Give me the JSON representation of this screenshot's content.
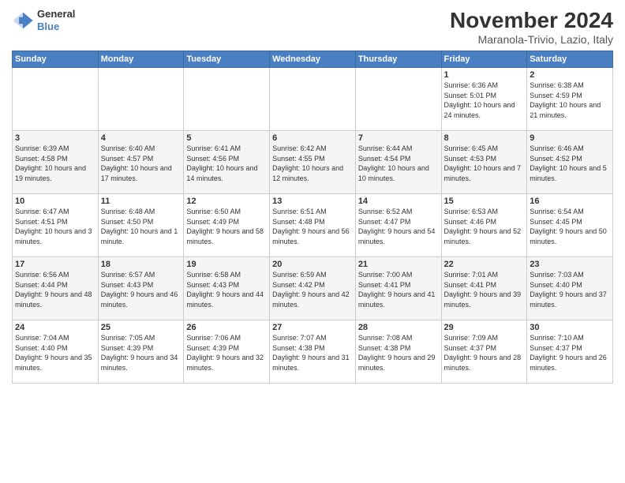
{
  "logo": {
    "general": "General",
    "blue": "Blue"
  },
  "title": "November 2024",
  "location": "Maranola-Trivio, Lazio, Italy",
  "headers": [
    "Sunday",
    "Monday",
    "Tuesday",
    "Wednesday",
    "Thursday",
    "Friday",
    "Saturday"
  ],
  "weeks": [
    [
      {
        "day": "",
        "info": ""
      },
      {
        "day": "",
        "info": ""
      },
      {
        "day": "",
        "info": ""
      },
      {
        "day": "",
        "info": ""
      },
      {
        "day": "",
        "info": ""
      },
      {
        "day": "1",
        "info": "Sunrise: 6:36 AM\nSunset: 5:01 PM\nDaylight: 10 hours and 24 minutes."
      },
      {
        "day": "2",
        "info": "Sunrise: 6:38 AM\nSunset: 4:59 PM\nDaylight: 10 hours and 21 minutes."
      }
    ],
    [
      {
        "day": "3",
        "info": "Sunrise: 6:39 AM\nSunset: 4:58 PM\nDaylight: 10 hours and 19 minutes."
      },
      {
        "day": "4",
        "info": "Sunrise: 6:40 AM\nSunset: 4:57 PM\nDaylight: 10 hours and 17 minutes."
      },
      {
        "day": "5",
        "info": "Sunrise: 6:41 AM\nSunset: 4:56 PM\nDaylight: 10 hours and 14 minutes."
      },
      {
        "day": "6",
        "info": "Sunrise: 6:42 AM\nSunset: 4:55 PM\nDaylight: 10 hours and 12 minutes."
      },
      {
        "day": "7",
        "info": "Sunrise: 6:44 AM\nSunset: 4:54 PM\nDaylight: 10 hours and 10 minutes."
      },
      {
        "day": "8",
        "info": "Sunrise: 6:45 AM\nSunset: 4:53 PM\nDaylight: 10 hours and 7 minutes."
      },
      {
        "day": "9",
        "info": "Sunrise: 6:46 AM\nSunset: 4:52 PM\nDaylight: 10 hours and 5 minutes."
      }
    ],
    [
      {
        "day": "10",
        "info": "Sunrise: 6:47 AM\nSunset: 4:51 PM\nDaylight: 10 hours and 3 minutes."
      },
      {
        "day": "11",
        "info": "Sunrise: 6:48 AM\nSunset: 4:50 PM\nDaylight: 10 hours and 1 minute."
      },
      {
        "day": "12",
        "info": "Sunrise: 6:50 AM\nSunset: 4:49 PM\nDaylight: 9 hours and 58 minutes."
      },
      {
        "day": "13",
        "info": "Sunrise: 6:51 AM\nSunset: 4:48 PM\nDaylight: 9 hours and 56 minutes."
      },
      {
        "day": "14",
        "info": "Sunrise: 6:52 AM\nSunset: 4:47 PM\nDaylight: 9 hours and 54 minutes."
      },
      {
        "day": "15",
        "info": "Sunrise: 6:53 AM\nSunset: 4:46 PM\nDaylight: 9 hours and 52 minutes."
      },
      {
        "day": "16",
        "info": "Sunrise: 6:54 AM\nSunset: 4:45 PM\nDaylight: 9 hours and 50 minutes."
      }
    ],
    [
      {
        "day": "17",
        "info": "Sunrise: 6:56 AM\nSunset: 4:44 PM\nDaylight: 9 hours and 48 minutes."
      },
      {
        "day": "18",
        "info": "Sunrise: 6:57 AM\nSunset: 4:43 PM\nDaylight: 9 hours and 46 minutes."
      },
      {
        "day": "19",
        "info": "Sunrise: 6:58 AM\nSunset: 4:43 PM\nDaylight: 9 hours and 44 minutes."
      },
      {
        "day": "20",
        "info": "Sunrise: 6:59 AM\nSunset: 4:42 PM\nDaylight: 9 hours and 42 minutes."
      },
      {
        "day": "21",
        "info": "Sunrise: 7:00 AM\nSunset: 4:41 PM\nDaylight: 9 hours and 41 minutes."
      },
      {
        "day": "22",
        "info": "Sunrise: 7:01 AM\nSunset: 4:41 PM\nDaylight: 9 hours and 39 minutes."
      },
      {
        "day": "23",
        "info": "Sunrise: 7:03 AM\nSunset: 4:40 PM\nDaylight: 9 hours and 37 minutes."
      }
    ],
    [
      {
        "day": "24",
        "info": "Sunrise: 7:04 AM\nSunset: 4:40 PM\nDaylight: 9 hours and 35 minutes."
      },
      {
        "day": "25",
        "info": "Sunrise: 7:05 AM\nSunset: 4:39 PM\nDaylight: 9 hours and 34 minutes."
      },
      {
        "day": "26",
        "info": "Sunrise: 7:06 AM\nSunset: 4:39 PM\nDaylight: 9 hours and 32 minutes."
      },
      {
        "day": "27",
        "info": "Sunrise: 7:07 AM\nSunset: 4:38 PM\nDaylight: 9 hours and 31 minutes."
      },
      {
        "day": "28",
        "info": "Sunrise: 7:08 AM\nSunset: 4:38 PM\nDaylight: 9 hours and 29 minutes."
      },
      {
        "day": "29",
        "info": "Sunrise: 7:09 AM\nSunset: 4:37 PM\nDaylight: 9 hours and 28 minutes."
      },
      {
        "day": "30",
        "info": "Sunrise: 7:10 AM\nSunset: 4:37 PM\nDaylight: 9 hours and 26 minutes."
      }
    ]
  ]
}
